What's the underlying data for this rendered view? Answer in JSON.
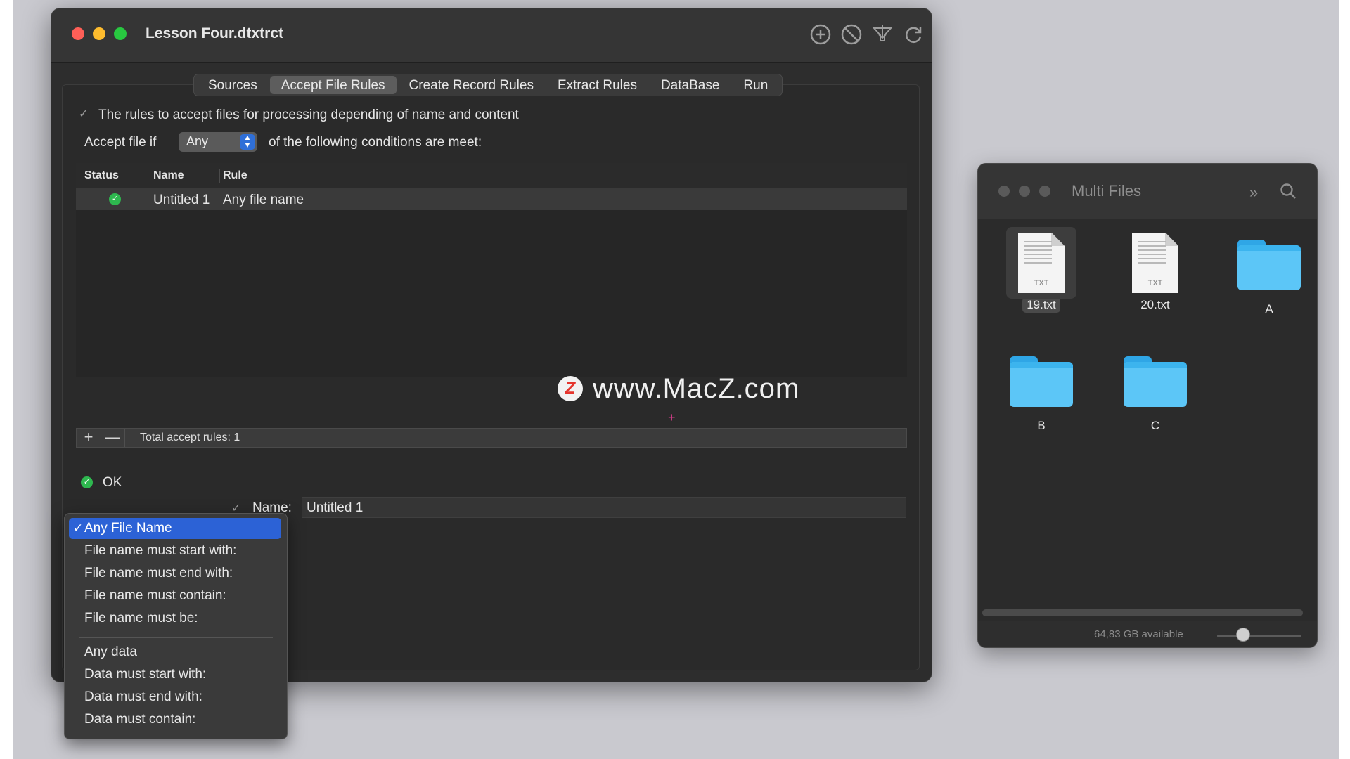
{
  "main_window": {
    "title": "Lesson Four.dtxtrct",
    "toolbar_icons": [
      "add-circle-icon",
      "prohibit-icon",
      "funnel-download-icon",
      "refresh-icon"
    ],
    "tabs": [
      "Sources",
      "Accept File Rules",
      "Create Record Rules",
      "Extract Rules",
      "DataBase",
      "Run"
    ],
    "active_tab": "Accept File Rules",
    "description": "The rules to accept files for processing depending of name and content",
    "accept_prefix": "Accept file if",
    "accept_mode": "Any",
    "accept_suffix": "of the following conditions are meet:",
    "table": {
      "columns": [
        "Status",
        "Name",
        "Rule"
      ],
      "rows": [
        {
          "status": "ok",
          "name": "Untitled 1",
          "rule": "Any file name"
        }
      ]
    },
    "footer": {
      "add_label": "+",
      "remove_label": "—",
      "total_label": "Total accept rules: 1"
    },
    "validation_status": "OK",
    "name_label": "Name:",
    "name_value": "Untitled 1",
    "rule_menu": {
      "selected": "Any File Name",
      "items_group1": [
        "Any File Name",
        "File name must start with:",
        "File name must end with:",
        "File name must contain:",
        "File name must be:"
      ],
      "items_group2": [
        "Any data",
        "Data must start with:",
        "Data must end with:",
        "Data must contain:"
      ]
    }
  },
  "watermark": {
    "logo_letter": "Z",
    "text": "www.MacZ.com"
  },
  "finder": {
    "title": "Multi Files",
    "items": [
      {
        "name": "19.txt",
        "kind": "txt",
        "ext": "TXT",
        "selected": true
      },
      {
        "name": "20.txt",
        "kind": "txt",
        "ext": "TXT",
        "selected": false
      },
      {
        "name": "A",
        "kind": "folder",
        "selected": false
      },
      {
        "name": "B",
        "kind": "folder",
        "selected": false
      },
      {
        "name": "C",
        "kind": "folder",
        "selected": false
      }
    ],
    "available": "64,83 GB available"
  },
  "colors": {
    "accent_blue": "#2c62d6",
    "status_green": "#2eb84f",
    "folder_blue": "#5cc6f7"
  }
}
